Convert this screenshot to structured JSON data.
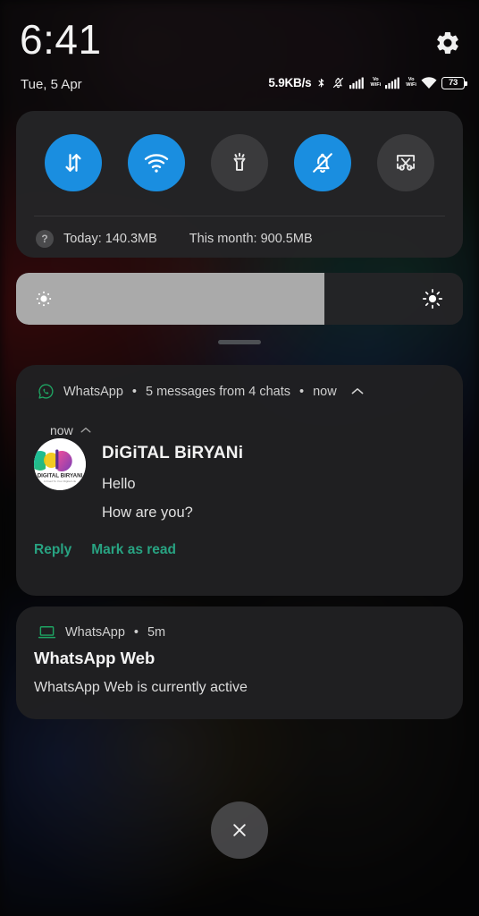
{
  "statusbar": {
    "clock": "6:41",
    "date": "Tue, 5 Apr",
    "net_speed": "5.9KB/s",
    "settings_icon": "gear-icon",
    "bluetooth_icon": "bluetooth-icon",
    "mute_icon": "bell-muted-icon",
    "signal1_icon": "cellular-signal-icon",
    "signal1_label": "Vo\nWiFi",
    "vo_top": "Vo",
    "vo_bottom": "WiFi",
    "signal2_icon": "cellular-signal-icon",
    "wifi_icon": "wifi-icon",
    "battery_level": "73"
  },
  "quick_settings": {
    "toggles": [
      {
        "name": "mobile-data",
        "icon": "data-transfer-icon",
        "state": "on"
      },
      {
        "name": "wifi",
        "icon": "wifi-icon",
        "state": "on"
      },
      {
        "name": "flashlight",
        "icon": "flashlight-icon",
        "state": "off"
      },
      {
        "name": "silent-mode",
        "icon": "bell-muted-icon",
        "state": "on"
      },
      {
        "name": "screenshot",
        "icon": "screenshot-scissors-icon",
        "state": "off"
      }
    ],
    "help_icon_label": "?",
    "usage_today": "Today: 140.3MB",
    "usage_month": "This month: 900.5MB"
  },
  "brightness": {
    "level_percent": 69,
    "low_icon": "brightness-low-icon",
    "high_icon": "brightness-high-icon"
  },
  "notifications": [
    {
      "id": "whatsapp-messages",
      "app_icon": "whatsapp-icon",
      "app_name": "WhatsApp",
      "summary": "5 messages from 4 chats",
      "time": "now",
      "collapse_icon": "chevron-up-icon",
      "group_time": "now",
      "group_collapse_icon": "chevron-up-icon",
      "avatar_name": "digital-biryani-avatar",
      "avatar_text": "DIGITAL BIRYANI",
      "avatar_tagline": "A Road To Your Digital Life",
      "sender": "DiGiTAL BiRYANi",
      "messages": [
        "Hello",
        "How are you?"
      ],
      "actions": [
        "Reply",
        "Mark as read"
      ]
    },
    {
      "id": "whatsapp-web",
      "app_icon": "laptop-icon",
      "app_name": "WhatsApp",
      "time": "5m",
      "title": "WhatsApp Web",
      "body": "WhatsApp Web is currently active"
    }
  ],
  "clear_all": {
    "icon": "close-x-icon"
  },
  "separators": {
    "dot": "•"
  },
  "colors": {
    "accent_blue": "#1a8ee0",
    "whatsapp_green": "#1fa463",
    "action_green": "#28a382",
    "card_bg": "#202022",
    "panel_bg": "#242426",
    "brightness_fill": "#aaaaaa"
  }
}
